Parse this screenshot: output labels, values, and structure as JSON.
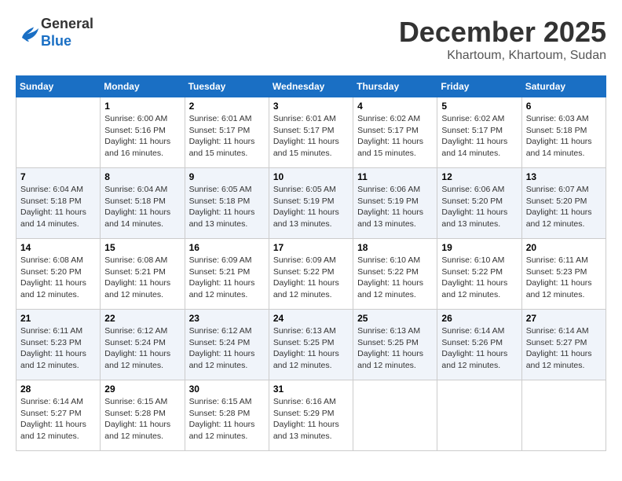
{
  "header": {
    "logo_line1": "General",
    "logo_line2": "Blue",
    "month": "December 2025",
    "location": "Khartoum, Khartoum, Sudan"
  },
  "days_of_week": [
    "Sunday",
    "Monday",
    "Tuesday",
    "Wednesday",
    "Thursday",
    "Friday",
    "Saturday"
  ],
  "weeks": [
    [
      {
        "num": "",
        "sunrise": "",
        "sunset": "",
        "daylight": ""
      },
      {
        "num": "1",
        "sunrise": "Sunrise: 6:00 AM",
        "sunset": "Sunset: 5:16 PM",
        "daylight": "Daylight: 11 hours and 16 minutes."
      },
      {
        "num": "2",
        "sunrise": "Sunrise: 6:01 AM",
        "sunset": "Sunset: 5:17 PM",
        "daylight": "Daylight: 11 hours and 15 minutes."
      },
      {
        "num": "3",
        "sunrise": "Sunrise: 6:01 AM",
        "sunset": "Sunset: 5:17 PM",
        "daylight": "Daylight: 11 hours and 15 minutes."
      },
      {
        "num": "4",
        "sunrise": "Sunrise: 6:02 AM",
        "sunset": "Sunset: 5:17 PM",
        "daylight": "Daylight: 11 hours and 15 minutes."
      },
      {
        "num": "5",
        "sunrise": "Sunrise: 6:02 AM",
        "sunset": "Sunset: 5:17 PM",
        "daylight": "Daylight: 11 hours and 14 minutes."
      },
      {
        "num": "6",
        "sunrise": "Sunrise: 6:03 AM",
        "sunset": "Sunset: 5:18 PM",
        "daylight": "Daylight: 11 hours and 14 minutes."
      }
    ],
    [
      {
        "num": "7",
        "sunrise": "Sunrise: 6:04 AM",
        "sunset": "Sunset: 5:18 PM",
        "daylight": "Daylight: 11 hours and 14 minutes."
      },
      {
        "num": "8",
        "sunrise": "Sunrise: 6:04 AM",
        "sunset": "Sunset: 5:18 PM",
        "daylight": "Daylight: 11 hours and 14 minutes."
      },
      {
        "num": "9",
        "sunrise": "Sunrise: 6:05 AM",
        "sunset": "Sunset: 5:18 PM",
        "daylight": "Daylight: 11 hours and 13 minutes."
      },
      {
        "num": "10",
        "sunrise": "Sunrise: 6:05 AM",
        "sunset": "Sunset: 5:19 PM",
        "daylight": "Daylight: 11 hours and 13 minutes."
      },
      {
        "num": "11",
        "sunrise": "Sunrise: 6:06 AM",
        "sunset": "Sunset: 5:19 PM",
        "daylight": "Daylight: 11 hours and 13 minutes."
      },
      {
        "num": "12",
        "sunrise": "Sunrise: 6:06 AM",
        "sunset": "Sunset: 5:20 PM",
        "daylight": "Daylight: 11 hours and 13 minutes."
      },
      {
        "num": "13",
        "sunrise": "Sunrise: 6:07 AM",
        "sunset": "Sunset: 5:20 PM",
        "daylight": "Daylight: 11 hours and 12 minutes."
      }
    ],
    [
      {
        "num": "14",
        "sunrise": "Sunrise: 6:08 AM",
        "sunset": "Sunset: 5:20 PM",
        "daylight": "Daylight: 11 hours and 12 minutes."
      },
      {
        "num": "15",
        "sunrise": "Sunrise: 6:08 AM",
        "sunset": "Sunset: 5:21 PM",
        "daylight": "Daylight: 11 hours and 12 minutes."
      },
      {
        "num": "16",
        "sunrise": "Sunrise: 6:09 AM",
        "sunset": "Sunset: 5:21 PM",
        "daylight": "Daylight: 11 hours and 12 minutes."
      },
      {
        "num": "17",
        "sunrise": "Sunrise: 6:09 AM",
        "sunset": "Sunset: 5:22 PM",
        "daylight": "Daylight: 11 hours and 12 minutes."
      },
      {
        "num": "18",
        "sunrise": "Sunrise: 6:10 AM",
        "sunset": "Sunset: 5:22 PM",
        "daylight": "Daylight: 11 hours and 12 minutes."
      },
      {
        "num": "19",
        "sunrise": "Sunrise: 6:10 AM",
        "sunset": "Sunset: 5:22 PM",
        "daylight": "Daylight: 11 hours and 12 minutes."
      },
      {
        "num": "20",
        "sunrise": "Sunrise: 6:11 AM",
        "sunset": "Sunset: 5:23 PM",
        "daylight": "Daylight: 11 hours and 12 minutes."
      }
    ],
    [
      {
        "num": "21",
        "sunrise": "Sunrise: 6:11 AM",
        "sunset": "Sunset: 5:23 PM",
        "daylight": "Daylight: 11 hours and 12 minutes."
      },
      {
        "num": "22",
        "sunrise": "Sunrise: 6:12 AM",
        "sunset": "Sunset: 5:24 PM",
        "daylight": "Daylight: 11 hours and 12 minutes."
      },
      {
        "num": "23",
        "sunrise": "Sunrise: 6:12 AM",
        "sunset": "Sunset: 5:24 PM",
        "daylight": "Daylight: 11 hours and 12 minutes."
      },
      {
        "num": "24",
        "sunrise": "Sunrise: 6:13 AM",
        "sunset": "Sunset: 5:25 PM",
        "daylight": "Daylight: 11 hours and 12 minutes."
      },
      {
        "num": "25",
        "sunrise": "Sunrise: 6:13 AM",
        "sunset": "Sunset: 5:25 PM",
        "daylight": "Daylight: 11 hours and 12 minutes."
      },
      {
        "num": "26",
        "sunrise": "Sunrise: 6:14 AM",
        "sunset": "Sunset: 5:26 PM",
        "daylight": "Daylight: 11 hours and 12 minutes."
      },
      {
        "num": "27",
        "sunrise": "Sunrise: 6:14 AM",
        "sunset": "Sunset: 5:27 PM",
        "daylight": "Daylight: 11 hours and 12 minutes."
      }
    ],
    [
      {
        "num": "28",
        "sunrise": "Sunrise: 6:14 AM",
        "sunset": "Sunset: 5:27 PM",
        "daylight": "Daylight: 11 hours and 12 minutes."
      },
      {
        "num": "29",
        "sunrise": "Sunrise: 6:15 AM",
        "sunset": "Sunset: 5:28 PM",
        "daylight": "Daylight: 11 hours and 12 minutes."
      },
      {
        "num": "30",
        "sunrise": "Sunrise: 6:15 AM",
        "sunset": "Sunset: 5:28 PM",
        "daylight": "Daylight: 11 hours and 12 minutes."
      },
      {
        "num": "31",
        "sunrise": "Sunrise: 6:16 AM",
        "sunset": "Sunset: 5:29 PM",
        "daylight": "Daylight: 11 hours and 13 minutes."
      },
      {
        "num": "",
        "sunrise": "",
        "sunset": "",
        "daylight": ""
      },
      {
        "num": "",
        "sunrise": "",
        "sunset": "",
        "daylight": ""
      },
      {
        "num": "",
        "sunrise": "",
        "sunset": "",
        "daylight": ""
      }
    ]
  ]
}
